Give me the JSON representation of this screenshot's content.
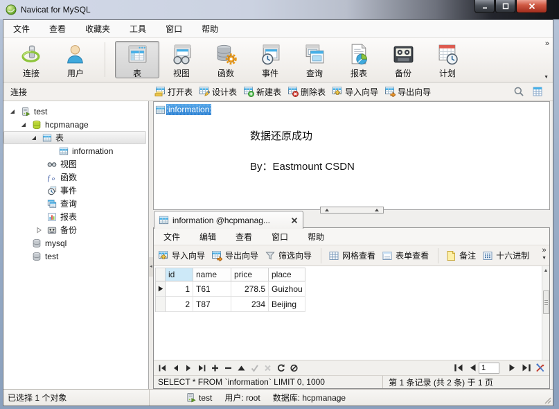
{
  "window": {
    "title": "Navicat for MySQL",
    "controls": [
      "minimize",
      "maximize",
      "close"
    ]
  },
  "menubar": {
    "items": [
      "文件",
      "查看",
      "收藏夹",
      "工具",
      "窗口",
      "帮助"
    ]
  },
  "main_toolbar": {
    "items": [
      {
        "label": "连接",
        "icon": "connection-icon"
      },
      {
        "label": "用户",
        "icon": "user-icon"
      },
      {
        "label": "表",
        "icon": "table-icon",
        "selected": true
      },
      {
        "label": "视图",
        "icon": "view-icon"
      },
      {
        "label": "函数",
        "icon": "function-icon"
      },
      {
        "label": "事件",
        "icon": "event-icon"
      },
      {
        "label": "查询",
        "icon": "query-icon"
      },
      {
        "label": "报表",
        "icon": "report-icon"
      },
      {
        "label": "备份",
        "icon": "backup-icon"
      },
      {
        "label": "计划",
        "icon": "schedule-icon"
      }
    ]
  },
  "object_toolbar": {
    "context_label": "连接",
    "buttons": [
      {
        "label": "打开表",
        "icon": "open-table-icon"
      },
      {
        "label": "设计表",
        "icon": "design-table-icon"
      },
      {
        "label": "新建表",
        "icon": "new-table-icon"
      },
      {
        "label": "删除表",
        "icon": "delete-table-icon"
      },
      {
        "label": "导入向导",
        "icon": "import-wizard-icon"
      },
      {
        "label": "导出向导",
        "icon": "export-wizard-icon"
      }
    ],
    "right_icons": [
      "search-icon",
      "column-grid-icon"
    ]
  },
  "sidebar": {
    "items": [
      {
        "label": "test",
        "icon": "server-icon",
        "state": "expanded"
      },
      {
        "label": "hcpmanage",
        "icon": "database-green-icon",
        "state": "expanded"
      },
      {
        "label": "表",
        "icon": "table-small-icon",
        "state": "expanded",
        "selected": true
      },
      {
        "label": "information",
        "icon": "table-small-icon"
      },
      {
        "label": "视图",
        "icon": "view-small-icon"
      },
      {
        "label": "函数",
        "icon": "function-small-icon"
      },
      {
        "label": "事件",
        "icon": "event-small-icon"
      },
      {
        "label": "查询",
        "icon": "query-small-icon"
      },
      {
        "label": "报表",
        "icon": "report-small-icon"
      },
      {
        "label": "备份",
        "icon": "backup-small-icon",
        "state": "collapsed"
      },
      {
        "label": "mysql",
        "icon": "database-gray-icon"
      },
      {
        "label": "test",
        "icon": "database-gray-icon"
      }
    ]
  },
  "object_pane": {
    "selected_object": "information"
  },
  "annotation": {
    "line1": "数据还原成功",
    "line2": "By：Eastmount CSDN",
    "color": "#ff0000"
  },
  "table_window": {
    "tab": {
      "title": "information @hcpmanag...",
      "icon": "table-small-icon"
    },
    "menu": {
      "items": [
        "文件",
        "编辑",
        "查看",
        "窗口",
        "帮助"
      ]
    },
    "toolbar": {
      "buttons": [
        {
          "label": "导入向导",
          "icon": "import-wizard-icon"
        },
        {
          "label": "导出向导",
          "icon": "export-wizard-icon"
        },
        {
          "label": "筛选向导",
          "icon": "filter-wizard-icon"
        },
        {
          "label": "网格查看",
          "icon": "grid-view-icon"
        },
        {
          "label": "表单查看",
          "icon": "form-view-icon"
        },
        {
          "label": "备注",
          "icon": "memo-icon"
        },
        {
          "label": "十六进制",
          "icon": "hex-icon"
        }
      ]
    },
    "grid": {
      "columns": [
        "id",
        "name",
        "price",
        "place"
      ],
      "rows": [
        [
          "1",
          "T61",
          "278.5",
          "Guizhou"
        ],
        [
          "2",
          "T87",
          "234",
          "Beijing"
        ]
      ]
    },
    "pager": {
      "page_value": "1"
    },
    "status": {
      "sql": "SELECT * FROM `information` LIMIT 0, 1000",
      "record_info": "第 1 条记录 (共 2 条) 于 1 页"
    }
  },
  "statusbar": {
    "selection_info": "已选择 1 个对象",
    "connection_name": "test",
    "user_info": "用户: root",
    "database_info": "数据库: hcpmanage"
  },
  "colors": {
    "annotation_red": "#ff0000",
    "selection_blue": "#2f8be0",
    "close_button_red": "#c24434",
    "titlebar_light": "#ccd4e6",
    "aero_border": "#8fa6c4"
  }
}
